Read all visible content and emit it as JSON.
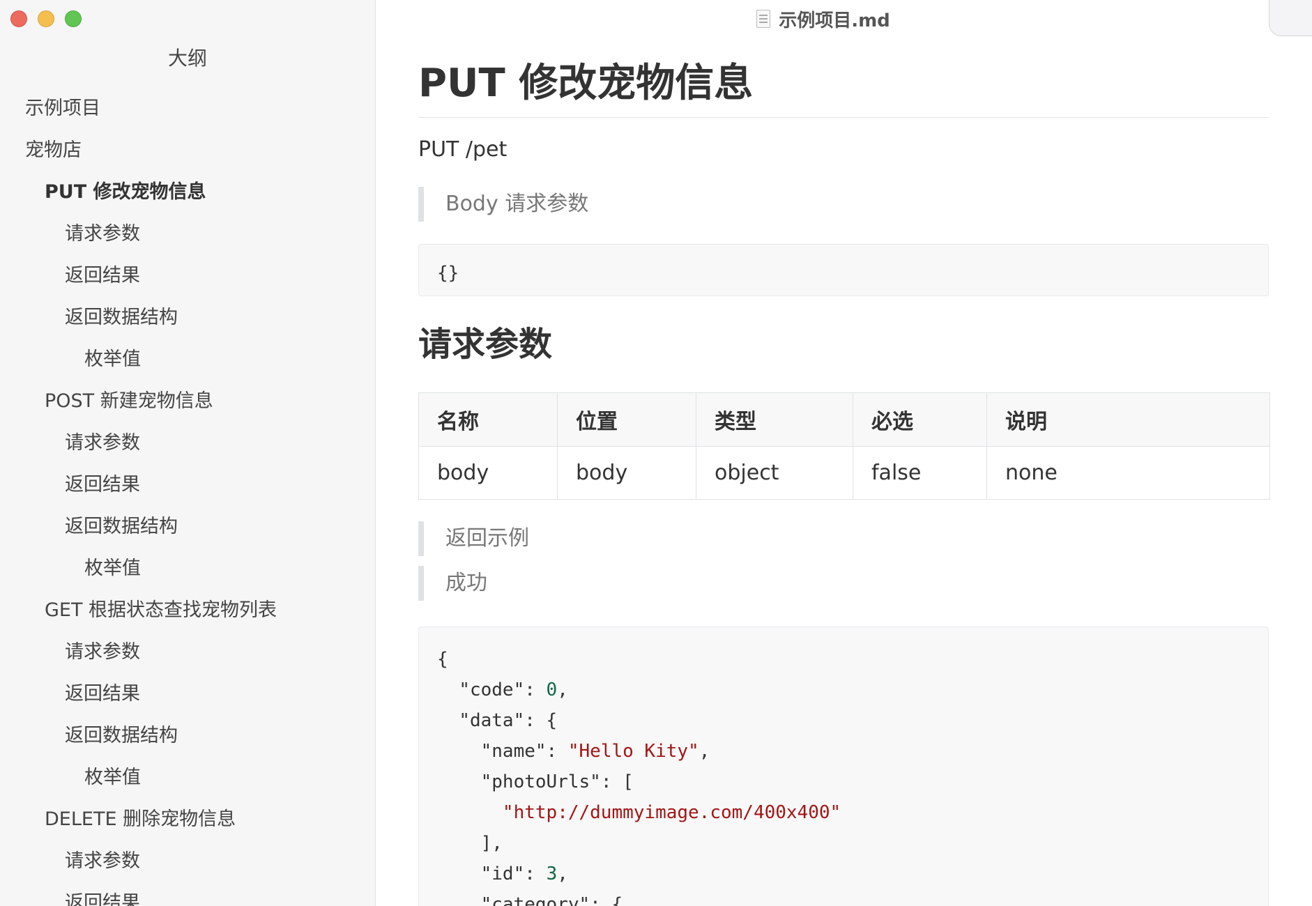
{
  "window": {
    "doc_title": "示例项目.md",
    "traffic_lights": [
      "close",
      "minimize",
      "maximize"
    ]
  },
  "sidebar": {
    "title": "大纲",
    "items": [
      {
        "label": "示例项目",
        "level": 1,
        "active": false
      },
      {
        "label": "宠物店",
        "level": 1,
        "active": false
      },
      {
        "label": "PUT 修改宠物信息",
        "level": 2,
        "active": true
      },
      {
        "label": "请求参数",
        "level": 3,
        "active": false
      },
      {
        "label": "返回结果",
        "level": 3,
        "active": false
      },
      {
        "label": "返回数据结构",
        "level": 3,
        "active": false
      },
      {
        "label": "枚举值",
        "level": 4,
        "active": false
      },
      {
        "label": "POST 新建宠物信息",
        "level": 2,
        "active": false
      },
      {
        "label": "请求参数",
        "level": 3,
        "active": false
      },
      {
        "label": "返回结果",
        "level": 3,
        "active": false
      },
      {
        "label": "返回数据结构",
        "level": 3,
        "active": false
      },
      {
        "label": "枚举值",
        "level": 4,
        "active": false
      },
      {
        "label": "GET 根据状态查找宠物列表",
        "level": 2,
        "active": false
      },
      {
        "label": "请求参数",
        "level": 3,
        "active": false
      },
      {
        "label": "返回结果",
        "level": 3,
        "active": false
      },
      {
        "label": "返回数据结构",
        "level": 3,
        "active": false
      },
      {
        "label": "枚举值",
        "level": 4,
        "active": false
      },
      {
        "label": "DELETE 删除宠物信息",
        "level": 2,
        "active": false
      },
      {
        "label": "请求参数",
        "level": 3,
        "active": false
      },
      {
        "label": "返回结果",
        "level": 3,
        "active": false
      }
    ]
  },
  "main": {
    "heading": "PUT 修改宠物信息",
    "path": "PUT /pet",
    "body_quote": "Body 请求参数",
    "body_code": "{}",
    "params_heading": "请求参数",
    "table": {
      "headers": [
        "名称",
        "位置",
        "类型",
        "必选",
        "说明"
      ],
      "rows": [
        [
          "body",
          "body",
          "object",
          "false",
          "none"
        ]
      ]
    },
    "example_quote": "返回示例",
    "success_quote": "成功",
    "json_example": {
      "open": "{",
      "code_key": "\"code\"",
      "code_val": "0",
      "data_key": "\"data\"",
      "name_key": "\"name\"",
      "name_val": "\"Hello Kity\"",
      "photo_key": "\"photoUrls\"",
      "photo_val": "\"http://dummyimage.com/400x400\"",
      "id_key": "\"id\"",
      "id_val": "3",
      "category_key": "\"category\""
    }
  },
  "colors": {
    "sidebar_bg": "#f6f6f6",
    "code_bg": "#f8f8f8",
    "string": "#a31515",
    "number": "#116644",
    "quote_bar": "#dfe2e5"
  }
}
